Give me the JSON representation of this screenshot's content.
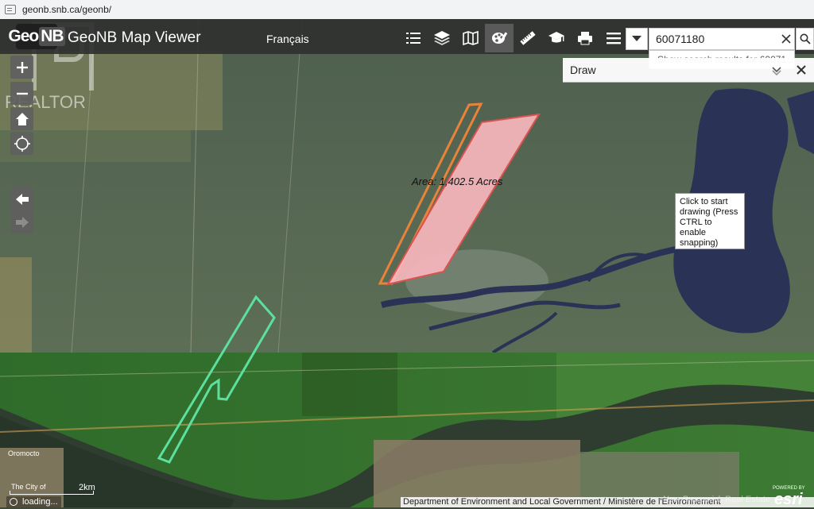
{
  "browser": {
    "url": "geonb.snb.ca/geonb/"
  },
  "header": {
    "logo_text_left": "Geo",
    "logo_text_right": "NB",
    "title": "GeoNB Map Viewer",
    "language_link": "Français"
  },
  "toolbar": {
    "tools": [
      {
        "icon": "layer-list-icon"
      },
      {
        "icon": "layers-icon"
      },
      {
        "icon": "basemap-icon"
      },
      {
        "icon": "draw-icon",
        "active": true
      },
      {
        "icon": "measure-icon"
      },
      {
        "icon": "education-icon"
      },
      {
        "icon": "print-icon"
      },
      {
        "icon": "menu-icon"
      }
    ]
  },
  "search": {
    "value": "60071180",
    "suggestion": "Show search results for 60071..."
  },
  "draw_panel": {
    "title": "Draw"
  },
  "map": {
    "area_label": "Area: 1,402.5 Acres",
    "tooltip": "Click to start drawing (Press CTRL to enable snapping)",
    "scale_label": "2km",
    "loading_text": "loading...",
    "attribution": "Department of Environment and Local Government / Ministère de l'Environnement",
    "watermark": "New Brunswick Real Estate",
    "esri_powered": "POWERED BY",
    "esri_logo": "esri",
    "places": {
      "oromocto": "Oromocto",
      "city": "The City of"
    }
  },
  "watermark_brand": "REALTOR",
  "colors": {
    "header_bg": "#303030",
    "polygon_red_fill": "#f7b6bd",
    "polygon_red_stroke": "#d9534f",
    "polygon_orange_stroke": "#e8833a",
    "polygon_green_stroke": "#5be0a0"
  }
}
